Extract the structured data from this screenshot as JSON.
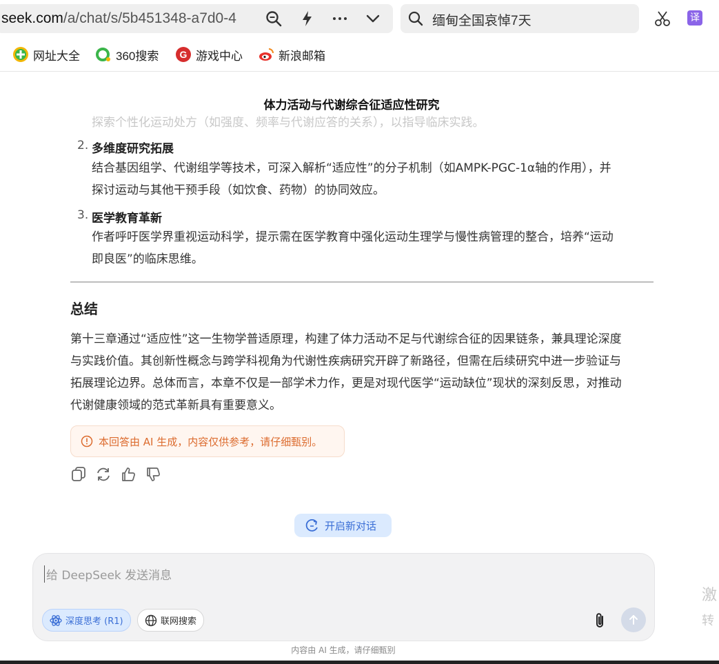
{
  "browser": {
    "url_host": "seek.com",
    "url_path": "/a/chat/s/5b451348-a7d0-4",
    "search_query": "缅甸全国哀悼7天",
    "translate_label": "译"
  },
  "bookmarks": [
    {
      "label": "网址大全"
    },
    {
      "label": "360搜索"
    },
    {
      "label": "游戏中心"
    },
    {
      "label": "新浪邮箱"
    }
  ],
  "doc": {
    "title": "体力活动与代谢综合征适应性研究",
    "faded_line": "探索个性化运动处方（如强度、频率与代谢应答的关系），以指导临床实践。",
    "items": [
      {
        "num": "2.",
        "heading": "多维度研究拓展",
        "lines": [
          "结合基因组学、代谢组学等技术，可深入解析“适应性”的分子机制（如AMPK-PGC-1α轴的作用），并",
          "探讨运动与其他干预手段（如饮食、药物）的协同效应。"
        ]
      },
      {
        "num": "3.",
        "heading": "医学教育革新",
        "lines": [
          "作者呼吁医学界重视运动科学，提示需在医学教育中强化运动生理学与慢性病管理的整合，培养“运动",
          "即良医”的临床思维。"
        ]
      }
    ],
    "summary_heading": "总结",
    "summary_lines": [
      "第十三章通过“适应性”这一生物学普适原理，构建了体力活动不足与代谢综合征的因果链条，兼具理论深度",
      "与实践价值。其创新性概念与跨学科视角为代谢性疾病研究开辟了新路径，但需在后续研究中进一步验证与",
      "拓展理论边界。总体而言，本章不仅是一部学术力作，更是对现代医学“运动缺位”现状的深刻反思，对推动",
      "代谢健康领域的范式革新具有重要意义。"
    ],
    "ai_notice": "本回答由 AI 生成，内容仅供参考，请仔细甄别。"
  },
  "new_chat_label": "开启新对话",
  "composer": {
    "placeholder": "给 DeepSeek 发送消息",
    "deep_think_label": "深度思考 (R1)",
    "web_search_label": "联网搜索"
  },
  "footer_note": "内容由 AI 生成，请仔细甄别",
  "side_overlay": {
    "line1": "激",
    "line2": "转"
  },
  "colors": {
    "accent": "#3b6fd6",
    "notice_text": "#dc6b2e",
    "pill_bg": "#dbeafe"
  }
}
